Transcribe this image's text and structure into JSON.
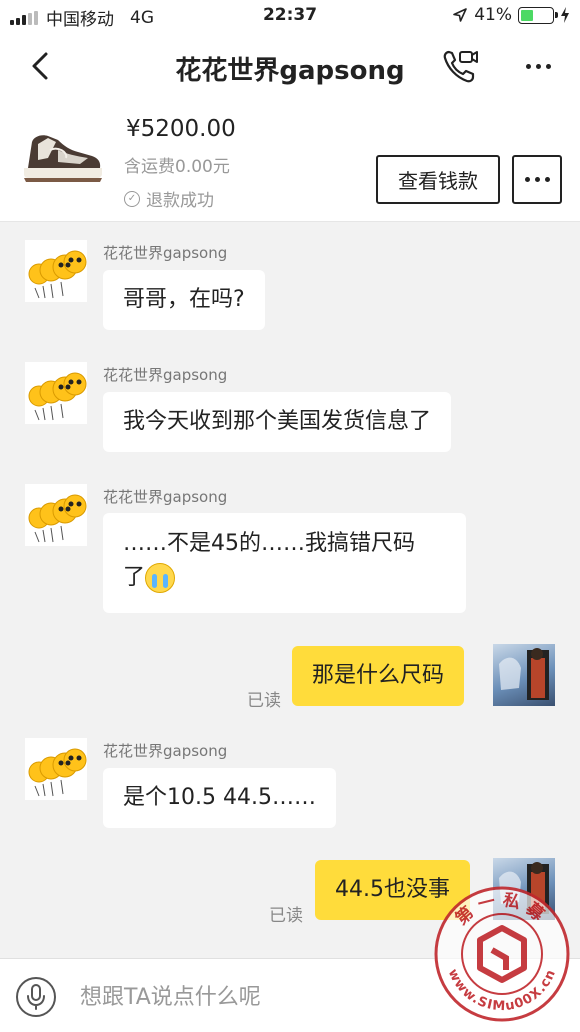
{
  "status_bar": {
    "carrier": "中国移动",
    "network": "4G",
    "time": "22:37",
    "battery_percent": "41%",
    "battery_level": 0.41
  },
  "header": {
    "title": "花花世界gapsong"
  },
  "product": {
    "price": "¥5200.00",
    "shipping": "含运费0.00元",
    "refund_status": "退款成功",
    "view_money_label": "查看钱款"
  },
  "messages": [
    {
      "sender": "花花世界gapsong",
      "text": "哥哥，在吗?",
      "from_me": false
    },
    {
      "sender": "花花世界gapsong",
      "text": "我今天收到那个美国发货信息了",
      "from_me": false
    },
    {
      "sender": "花花世界gapsong",
      "line1": "……不是45的……我搞错尺码",
      "line2": "了",
      "from_me": false
    },
    {
      "text": "那是什么尺码",
      "read": "已读",
      "from_me": true
    },
    {
      "sender": "花花世界gapsong",
      "text": "是个10.5 44.5……",
      "from_me": false
    },
    {
      "text": "44.5也没事",
      "read": "已读",
      "from_me": true
    }
  ],
  "input": {
    "placeholder": "想跟TA说点什么呢"
  },
  "watermark": {
    "top_text": "第一私募",
    "bottom_text": "www.SIMu00X.cn"
  },
  "colors": {
    "my_bubble": "#ffdc3b",
    "battery_fill": "#4cd964",
    "watermark_red": "#c0282d"
  }
}
